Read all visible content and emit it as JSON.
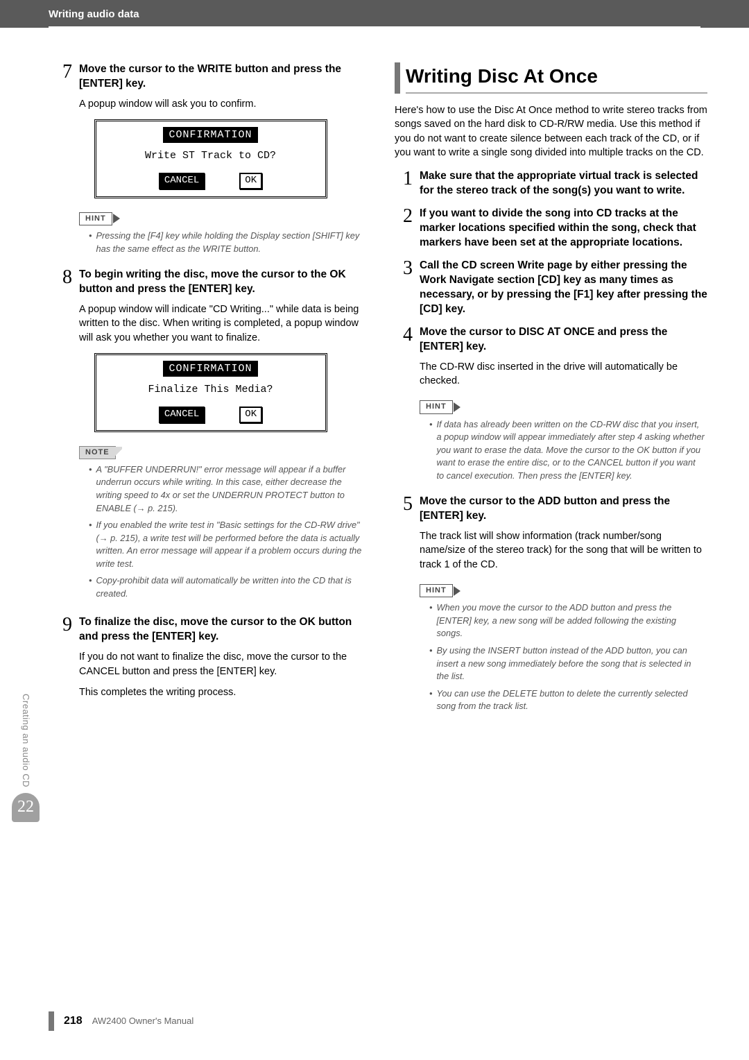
{
  "header": {
    "chapter": "Writing audio data"
  },
  "left": {
    "step7": {
      "num": "7",
      "head": "Move the cursor to the WRITE button and press the [ENTER] key.",
      "body": "A popup window will ask you to confirm."
    },
    "dlg1": {
      "title": "CONFIRMATION",
      "body": "Write ST Track to CD?",
      "btn1": "CANCEL",
      "btn2": "OK"
    },
    "hint1": {
      "label": "HINT",
      "text": "Pressing the [F4] key while holding the Display section [SHIFT] key has the same effect as the WRITE button."
    },
    "step8": {
      "num": "8",
      "head": "To begin writing the disc, move the cursor to the OK button and press the [ENTER] key.",
      "body": "A popup window will indicate \"CD Writing...\" while data is being written to the disc. When writing is completed, a popup window will ask you whether you want to finalize."
    },
    "dlg2": {
      "title": "CONFIRMATION",
      "body": "Finalize This Media?",
      "btn1": "CANCEL",
      "btn2": "OK"
    },
    "note": {
      "label": "NOTE",
      "n1": "A \"BUFFER UNDERRUN!\" error message will appear if a buffer underrun occurs while writing. In this case, either decrease the writing speed to 4x or set the UNDERRUN PROTECT button to ENABLE (→ p. 215).",
      "n2": "If you enabled the write test in \"Basic settings for the CD-RW drive\" (→ p. 215), a write test will be performed before the data is actually written. An error message will appear if a problem occurs during the write test.",
      "n3": "Copy-prohibit data will automatically be written into the CD that is created."
    },
    "step9": {
      "num": "9",
      "head": "To finalize the disc, move the cursor to the OK button and press the [ENTER] key.",
      "body1": "If you do not want to finalize the disc, move the cursor to the CANCEL button and press the [ENTER] key.",
      "body2": "This completes the writing process."
    }
  },
  "right": {
    "section": "Writing Disc At Once",
    "intro": "Here's how to use the Disc At Once method to write stereo tracks from songs saved on the hard disk to CD-R/RW media. Use this method if you do not want to create silence between each track of the CD, or if you want to write a single song divided into multiple tracks on the CD.",
    "s1": {
      "num": "1",
      "head": "Make sure that the appropriate virtual track is selected for the stereo track of the song(s) you want to write."
    },
    "s2": {
      "num": "2",
      "head": "If you want to divide the song into CD tracks at the marker locations specified within the song, check that markers have been set at the appropriate locations."
    },
    "s3": {
      "num": "3",
      "head": " Call the CD screen Write page by either pressing the Work Navigate section [CD] key as many times as necessary, or by pressing the [F1] key after pressing the [CD] key."
    },
    "s4": {
      "num": "4",
      "head": "Move the cursor to DISC AT ONCE and press the [ENTER] key.",
      "body": "The CD-RW disc inserted in the drive will automatically be checked."
    },
    "hint4": {
      "label": "HINT",
      "text": "If data has already been written on the CD-RW disc that you insert, a popup window will appear immediately after step 4 asking whether you want to erase the data. Move the cursor to the OK button if you want to erase the entire disc, or to the CANCEL button if you want to cancel execution. Then press the [ENTER] key."
    },
    "s5": {
      "num": "5",
      "head": "Move the cursor to the ADD button and press the [ENTER] key.",
      "body": "The track list will show information (track number/song name/size of the stereo track) for the song that will be written to track 1 of the CD."
    },
    "hint5": {
      "label": "HINT",
      "h1": "When you move the cursor to the ADD button and press the [ENTER] key, a new song will be added following the existing songs.",
      "h2": "By using the INSERT button instead of the ADD button, you can insert a new song immediately before the song that is selected in the list.",
      "h3": "You can use the DELETE button to delete the currently selected song from the track list."
    }
  },
  "sidebar": {
    "label": "Creating an audio CD",
    "chapter": "22"
  },
  "footer": {
    "page": "218",
    "manual": "AW2400  Owner's Manual"
  }
}
